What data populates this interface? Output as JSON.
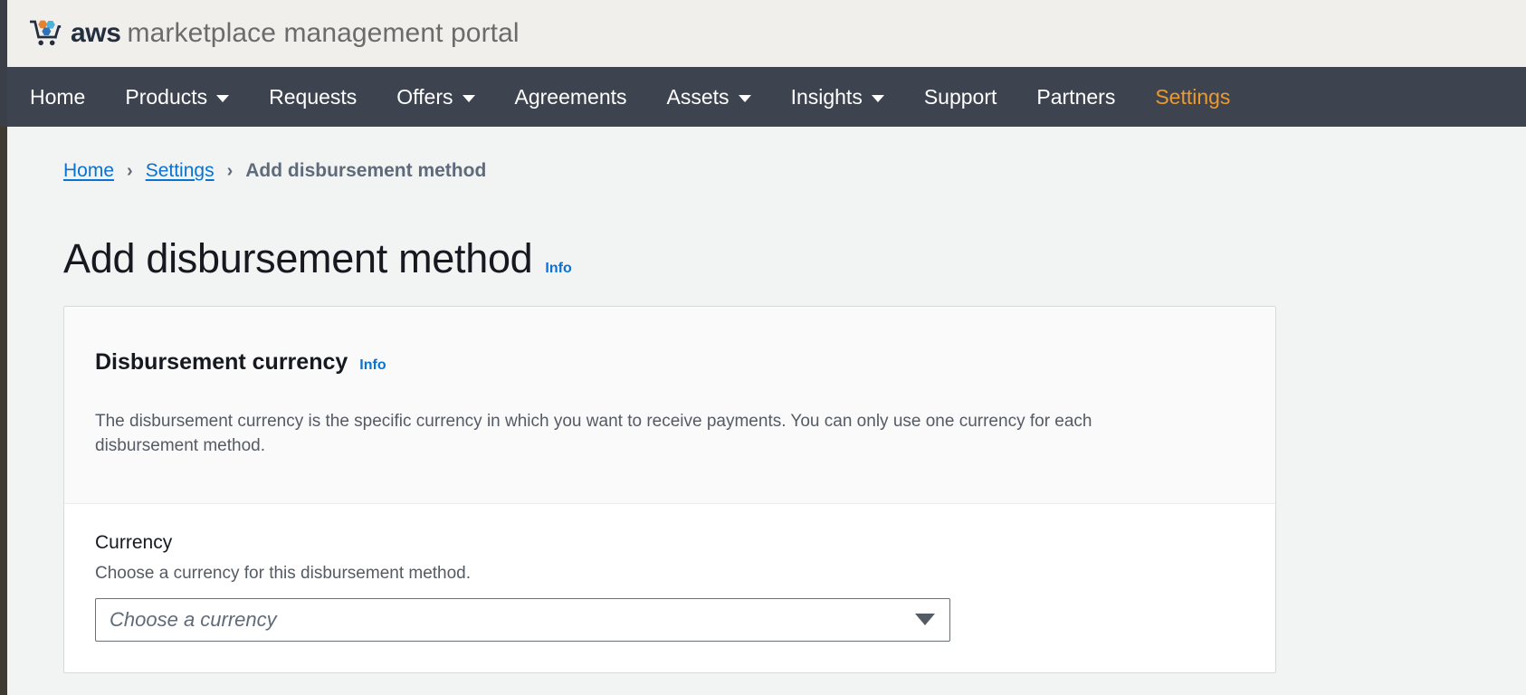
{
  "brand": {
    "logo_icon": "aws-marketplace-cart-icon",
    "aws_text": "aws",
    "product_text": "marketplace management portal",
    "logo_colors": {
      "hex_orange": "#E8822A",
      "hex_light_blue": "#4FB3D9",
      "hex_blue": "#2E73B8",
      "cart_outline": "#232F3E"
    }
  },
  "nav": {
    "active_color": "#EC9A2E",
    "background": "#3E444F",
    "items": [
      {
        "label": "Home",
        "has_caret": false,
        "active": false
      },
      {
        "label": "Products",
        "has_caret": true,
        "active": false
      },
      {
        "label": "Requests",
        "has_caret": false,
        "active": false
      },
      {
        "label": "Offers",
        "has_caret": true,
        "active": false
      },
      {
        "label": "Agreements",
        "has_caret": false,
        "active": false
      },
      {
        "label": "Assets",
        "has_caret": true,
        "active": false
      },
      {
        "label": "Insights",
        "has_caret": true,
        "active": false
      },
      {
        "label": "Support",
        "has_caret": false,
        "active": false
      },
      {
        "label": "Partners",
        "has_caret": false,
        "active": false
      },
      {
        "label": "Settings",
        "has_caret": false,
        "active": true
      }
    ]
  },
  "breadcrumb": {
    "items": [
      {
        "label": "Home",
        "is_link": true
      },
      {
        "label": "Settings",
        "is_link": true
      },
      {
        "label": "Add disbursement method",
        "is_link": false
      }
    ],
    "separator": "›",
    "link_color": "#0972D3"
  },
  "page": {
    "title": "Add disbursement method",
    "info_label": "Info"
  },
  "card": {
    "header_title": "Disbursement currency",
    "header_info_label": "Info",
    "description": "The disbursement currency is the specific currency in which you want to receive payments. You can only use one currency for each disbursement method.",
    "field": {
      "label": "Currency",
      "hint": "Choose a currency for this disbursement method.",
      "select_placeholder": "Choose a currency",
      "select_value": "",
      "caret_icon": "chevron-down-icon"
    }
  }
}
